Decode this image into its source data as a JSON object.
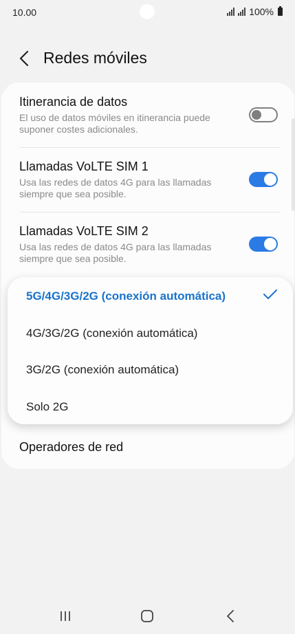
{
  "status_bar": {
    "time": "10.00",
    "battery": "100%"
  },
  "header": {
    "title": "Redes móviles"
  },
  "settings": {
    "roaming": {
      "title": "Itinerancia de datos",
      "subtitle": "El uso de datos móviles en itinerancia puede suponer costes adicionales.",
      "enabled": false
    },
    "volte1": {
      "title": "Llamadas VoLTE SIM 1",
      "subtitle": "Usa las redes de datos 4G para las llamadas siempre que sea posible.",
      "enabled": true
    },
    "volte2": {
      "title": "Llamadas VoLTE SIM 2",
      "subtitle": "Usa las redes de datos 4G para las llamadas siempre que sea posible.",
      "enabled": true
    },
    "operators": {
      "title": "Operadores de red"
    }
  },
  "network_mode_popup": {
    "options": [
      {
        "label": "5G/4G/3G/2G (conexión automática)",
        "selected": true
      },
      {
        "label": "4G/3G/2G (conexión automática)",
        "selected": false
      },
      {
        "label": "3G/2G (conexión automática)",
        "selected": false
      },
      {
        "label": "Solo 2G",
        "selected": false
      }
    ]
  },
  "colors": {
    "accent": "#2a7be4",
    "selected_text": "#1a73cc",
    "background": "#f2f2f2"
  },
  "icons": [
    "back-arrow-icon",
    "checkmark-icon",
    "recent-apps-icon",
    "home-icon",
    "back-nav-icon"
  ]
}
